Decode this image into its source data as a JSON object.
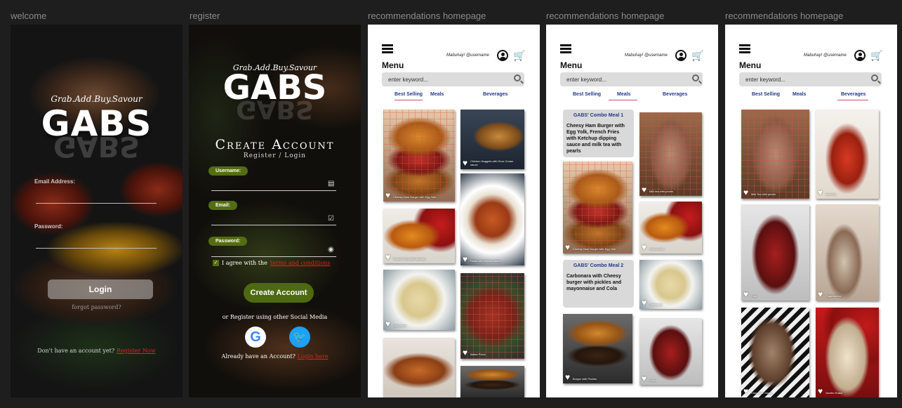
{
  "frames": {
    "welcome_label": "welcome",
    "register_label": "register",
    "home1_label": "recommendations homepage",
    "home2_label": "recommendations homepage",
    "home3_label": "recommendations homepage"
  },
  "brand": {
    "tagline": "Grab.Add.Buy.Savour",
    "logo": "GABS"
  },
  "welcome": {
    "email_label": "Email Address:",
    "password_label": "Password:",
    "login_button": "Login",
    "forgot": "forgot password?",
    "no_account": "Don't have an account yet?",
    "register_link": "Register Now"
  },
  "register": {
    "title": "Create Account",
    "subtitle": "Register / Login",
    "username_label": "Username:",
    "email_label": "Email:",
    "password_label": "Password:",
    "agree_text": "I agree with the",
    "terms_link": "terms and conditions",
    "create_button": "Create Account",
    "or_social": "or Register using other Social Media",
    "google": "G",
    "already": "Already have an Account?",
    "login_link": "Login here"
  },
  "home": {
    "greeting": "Mabuhay! @username",
    "menu_title": "Menu",
    "search_placeholder": "enter keyword...",
    "tabs": [
      "Best Selling",
      "Meals",
      "Beverages"
    ]
  },
  "best_selling": [
    "Cheesy Ham Burger with Egg Yolk",
    "Chicken Nuggets with Sour Cream sauce",
    "French Fries with Ketchup",
    "Pasta with tomato sauce",
    "Carbonara",
    "Italian Pizza"
  ],
  "meals": {
    "combo1_title": "GABS' Combo Meal 1",
    "combo1_desc": "Cheesy Ham Burger with Egg Yolk, French Fries with Ketchup dipping sauce and milk tea with pearls",
    "combo2_title": "GABS' Combo Meal 2",
    "combo2_desc": "Carbonara with Cheesy burger with pickles and mayonnaise and Cola",
    "captions": [
      "Cheesy Ham Burger with Egg Yolk",
      "Milk tea with pearls",
      "French fries",
      "Carbonara",
      "Burger with Pickles",
      "Cola"
    ]
  },
  "beverages": {
    "captions": [
      "Milk Tea with pearls",
      "Iced Tea",
      "Cola",
      "Frappuccino",
      "Chocolate Shake",
      "Vanilla Shake"
    ]
  },
  "colors": {
    "accent_green": "#546d12",
    "link_red": "#e52020",
    "tab_blue": "#233a8a"
  }
}
